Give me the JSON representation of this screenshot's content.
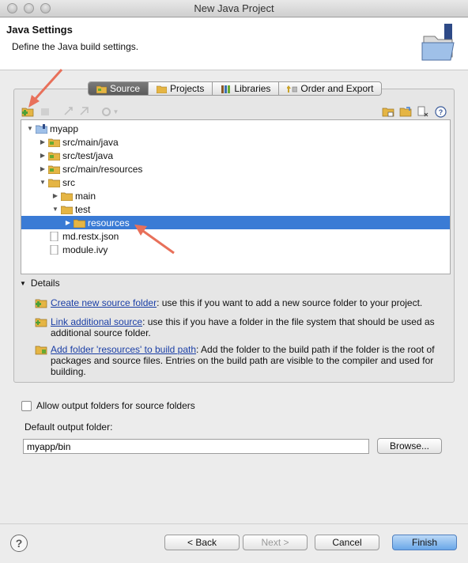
{
  "window": {
    "title": "New Java Project"
  },
  "header": {
    "title": "Java Settings",
    "subtitle": "Define the Java build settings."
  },
  "tabs": [
    {
      "label": "Source",
      "icon": "source-folder-icon",
      "active": true
    },
    {
      "label": "Projects",
      "icon": "projects-icon",
      "active": false
    },
    {
      "label": "Libraries",
      "icon": "libraries-icon",
      "active": false
    },
    {
      "label": "Order and Export",
      "icon": "order-export-icon",
      "active": false
    }
  ],
  "tree": {
    "items": [
      {
        "label": "myapp",
        "state": "expanded",
        "icon": "project-folder-icon"
      },
      {
        "label": "src/main/java",
        "state": "collapsed",
        "icon": "source-folder-icon"
      },
      {
        "label": "src/test/java",
        "state": "collapsed",
        "icon": "source-folder-icon"
      },
      {
        "label": "src/main/resources",
        "state": "collapsed",
        "icon": "source-folder-icon"
      },
      {
        "label": "src",
        "state": "expanded",
        "icon": "folder-icon"
      },
      {
        "label": "main",
        "state": "collapsed",
        "icon": "folder-icon"
      },
      {
        "label": "test",
        "state": "expanded",
        "icon": "folder-icon"
      },
      {
        "label": "resources",
        "state": "collapsed",
        "icon": "folder-icon",
        "selected": true
      },
      {
        "label": "md.restx.json",
        "state": "leaf",
        "icon": "file-icon"
      },
      {
        "label": "module.ivy",
        "state": "leaf",
        "icon": "file-icon"
      }
    ]
  },
  "details": {
    "label": "Details",
    "items": [
      {
        "link": "Create new source folder",
        "text": ": use this if you want to add a new source folder to your project."
      },
      {
        "link": "Link additional source",
        "text": ": use this if you have a folder in the file system that should be used as additional source folder."
      },
      {
        "link": "Add folder 'resources' to build path",
        "text": ": Add the folder to the build path if the folder is the root of packages and source files. Entries on the build path are visible to the compiler and used for building."
      }
    ]
  },
  "options": {
    "allow_output_label": "Allow output folders for source folders",
    "default_output_label": "Default output folder:",
    "default_output_value": "myapp/bin",
    "browse_label": "Browse..."
  },
  "footer": {
    "help": "?",
    "back_label": "< Back",
    "next_label": "Next >",
    "cancel_label": "Cancel",
    "finish_label": "Finish"
  },
  "colors": {
    "selection": "#3a7bd5",
    "folder": "#e5b544",
    "annotation_arrow": "#e8705a",
    "link": "#1b3fa6"
  }
}
